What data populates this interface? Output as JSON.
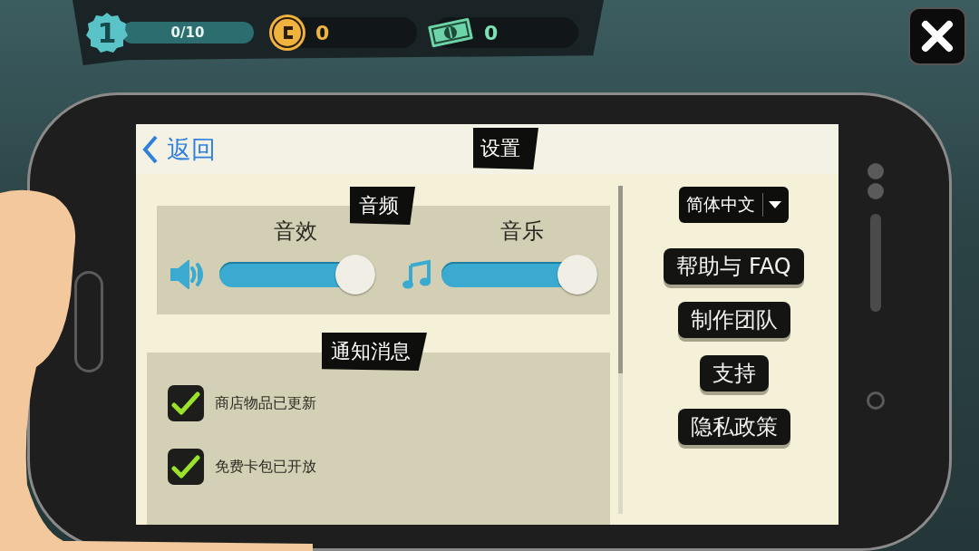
{
  "hud": {
    "level": "1",
    "xp": {
      "text": "0/10",
      "level": 0
    },
    "coins": "0",
    "cash": "0"
  },
  "screen": {
    "back_label": "返回",
    "title": "设置",
    "language": "简体中文",
    "audio": {
      "heading": "音频",
      "sliders": [
        {
          "kind": "sound",
          "label": "音效",
          "level": 1
        },
        {
          "kind": "music",
          "label": "音乐",
          "level": 1
        }
      ]
    },
    "notifications": {
      "heading": "通知消息",
      "items": [
        {
          "label": "商店物品已更新",
          "checked": true
        },
        {
          "label": "免费卡包已开放",
          "checked": true
        }
      ]
    },
    "buttons": [
      "帮助与 FAQ",
      "制作团队",
      "支持",
      "隐私政策"
    ]
  }
}
